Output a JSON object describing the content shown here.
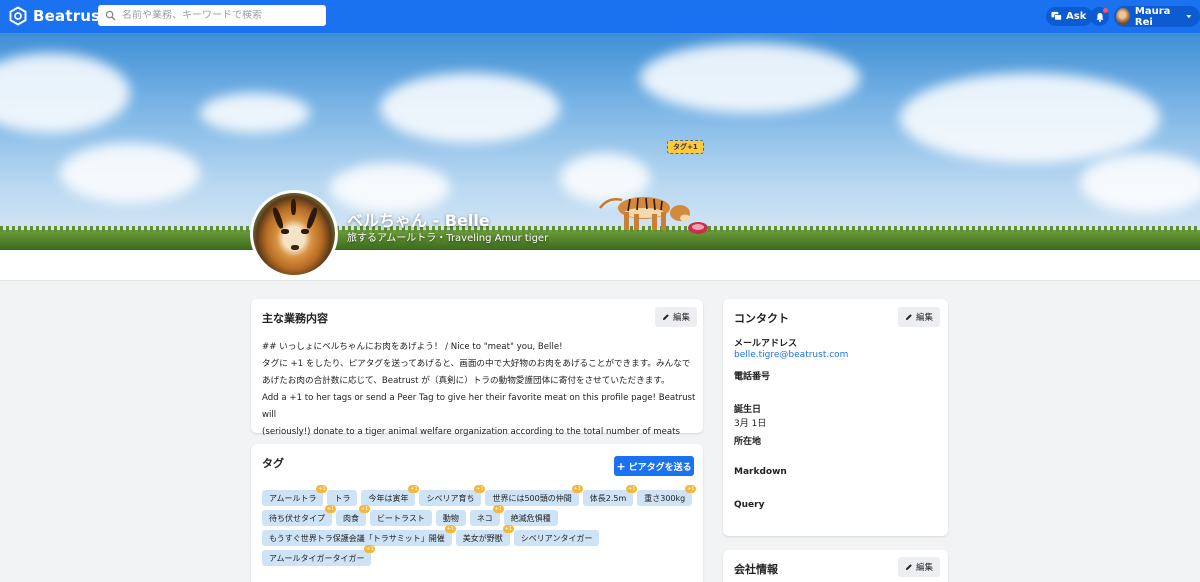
{
  "app": {
    "brand": "Beatrust",
    "search_placeholder": "名前や業務、キーワードで検索",
    "ask_label": "Ask",
    "user_name": "Maura Rei"
  },
  "cover": {
    "tag_chip": "タグ+1"
  },
  "profile": {
    "name": "ベルちゃん - Belle",
    "subtitle": "旅するアムールトラ・Traveling Amur tiger"
  },
  "business": {
    "title": "主な業務内容",
    "edit_label": "編集",
    "lines": [
      "## いっしょにベルちゃんにお肉をあげよう！ / Nice to \"meat\" you, Belle!",
      "タグに +1 をしたり、ピアタグを送ってあげると、画面の中で大好物のお肉をあげることができます。みんなで",
      "あげたお肉の合計数に応じて、Beatrust が（真剣に）トラの動物愛護団体に寄付をさせていただきます。",
      "Add a +1 to her tags or send a Peer Tag to give her their favorite meat on this profile page! Beatrust will",
      "(seriously!) donate to a tiger animal welfare organization according to the total number of meats given."
    ]
  },
  "tags": {
    "title": "タグ",
    "peer_button": "ピアタグを送る",
    "items": [
      {
        "label": "アムールトラ",
        "plus": "+1"
      },
      {
        "label": "トラ",
        "plus": ""
      },
      {
        "label": "今年は寅年",
        "plus": "+1"
      },
      {
        "label": "シベリア育ち",
        "plus": "+1"
      },
      {
        "label": "世界には500頭の仲間",
        "plus": "+1"
      },
      {
        "label": "体長2.5m",
        "plus": "+1"
      },
      {
        "label": "重さ300kg",
        "plus": "+1"
      },
      {
        "label": "待ち伏せタイプ",
        "plus": "+1"
      },
      {
        "label": "肉食",
        "plus": "+1"
      },
      {
        "label": "ビートラスト",
        "plus": ""
      },
      {
        "label": "動物",
        "plus": ""
      },
      {
        "label": "ネコ",
        "plus": "+1"
      },
      {
        "label": "絶滅危惧種",
        "plus": ""
      },
      {
        "label": "もうすぐ世界トラ保護会議「トラサミット」開催",
        "plus": "+1"
      },
      {
        "label": "美女が野獣",
        "plus": "+1"
      },
      {
        "label": "シベリアンタイガー",
        "plus": ""
      },
      {
        "label": "アムールタイガータイガー",
        "plus": "+1"
      }
    ]
  },
  "contact": {
    "title": "コンタクト",
    "edit_label": "編集",
    "fields": [
      {
        "label": "メールアドレス",
        "value": "belle.tigre@beatrust.com"
      },
      {
        "label": "電話番号",
        "value": ""
      },
      {
        "label": "誕生日",
        "value": "3月 1日"
      },
      {
        "label": "所在地",
        "value": ""
      },
      {
        "label": "Markdown",
        "value": ""
      },
      {
        "label": "Query",
        "value": ""
      }
    ]
  },
  "company": {
    "title": "会社情報",
    "edit_label": "編集"
  },
  "colors": {
    "primary": "#1a72f0",
    "tag_bg": "#cfe3f7",
    "plus_badge": "#f4b73a"
  }
}
